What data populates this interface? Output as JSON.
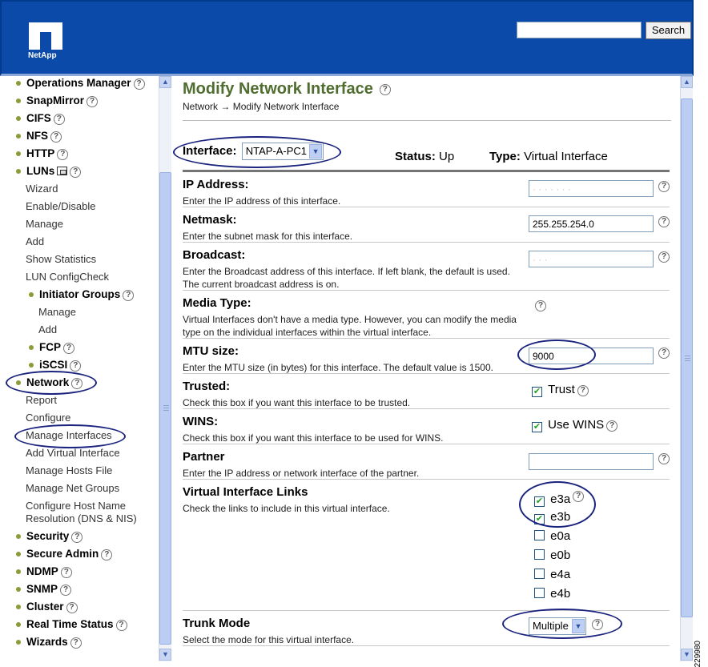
{
  "header": {
    "logo_text": "NetApp",
    "search_value": "",
    "search_button": "Search"
  },
  "sidebar": {
    "operations_manager": "Operations Manager",
    "snapmirror": "SnapMirror",
    "cifs": "CIFS",
    "nfs": "NFS",
    "http": "HTTP",
    "luns": "LUNs",
    "luns_wizard": "Wizard",
    "luns_enable": "Enable/Disable",
    "luns_manage": "Manage",
    "luns_add": "Add",
    "luns_stats": "Show Statistics",
    "luns_configcheck": "LUN ConfigCheck",
    "initiator_groups": "Initiator Groups",
    "ig_manage": "Manage",
    "ig_add": "Add",
    "fcp": "FCP",
    "iscsi": "iSCSI",
    "network": "Network",
    "net_report": "Report",
    "net_configure": "Configure",
    "net_manage_interfaces": "Manage Interfaces",
    "net_add_virtual": "Add Virtual Interface",
    "net_manage_hosts": "Manage Hosts File",
    "net_manage_netgroups": "Manage Net Groups",
    "net_host_name_1": "Configure Host Name",
    "net_host_name_2": "Resolution (DNS & NIS)",
    "security": "Security",
    "secure_admin": "Secure Admin",
    "ndmp": "NDMP",
    "snmp": "SNMP",
    "cluster": "Cluster",
    "real_time_status": "Real Time Status",
    "wizards": "Wizards"
  },
  "main": {
    "title": "Modify Network Interface",
    "breadcrumb": {
      "root": "Network",
      "arrow": "→",
      "current": "Modify Network Interface"
    },
    "interface_label": "Interface:",
    "interface_value": "NTAP-A-PC1",
    "status_label": "Status:",
    "status_value": "Up",
    "type_label": "Type:",
    "type_value": "Virtual Interface",
    "ip": {
      "title": "IP Address:",
      "desc": "Enter the IP address of this interface.",
      "value": "· · · · · · ·"
    },
    "netmask": {
      "title": "Netmask:",
      "desc": "Enter the subnet mask for this interface.",
      "value": "255.255.254.0"
    },
    "broadcast": {
      "title": "Broadcast:",
      "desc": "Enter the Broadcast address of this interface. If left blank, the default is used. The current broadcast address is on.",
      "value": "· · ·"
    },
    "media": {
      "title": "Media Type:",
      "desc": "Virtual Interfaces don't have a media type. However, you can modify the media type on the individual interfaces within the virtual interface."
    },
    "mtu": {
      "title": "MTU size:",
      "desc": "Enter the MTU size (in bytes) for this interface. The default value is 1500.",
      "value": "9000"
    },
    "trusted": {
      "title": "Trusted:",
      "desc": "Check this box if you want this interface to be trusted.",
      "checkbox_label": "Trust",
      "checked": true
    },
    "wins": {
      "title": "WINS:",
      "desc": "Check this box if you want this interface to be used for WINS.",
      "checkbox_label": "Use WINS",
      "checked": true
    },
    "partner": {
      "title": "Partner",
      "desc": "Enter the IP address or network interface of the partner.",
      "value": ""
    },
    "links": {
      "title": "Virtual Interface Links",
      "desc": "Check the links to include in this virtual interface.",
      "items": [
        {
          "label": "e3a",
          "checked": true
        },
        {
          "label": "e3b",
          "checked": true
        },
        {
          "label": "e0a",
          "checked": false
        },
        {
          "label": "e0b",
          "checked": false
        },
        {
          "label": "e4a",
          "checked": false
        },
        {
          "label": "e4b",
          "checked": false
        }
      ]
    },
    "trunk": {
      "title": "Trunk Mode",
      "desc": "Select the mode for this virtual interface.",
      "value": "Multiple"
    }
  },
  "figure_id": "229980",
  "colors": {
    "header_bg": "#0b4aa8",
    "title_green": "#4f6d2f",
    "highlight_oval": "#1a237e",
    "bullet": "#8a9b3a"
  }
}
